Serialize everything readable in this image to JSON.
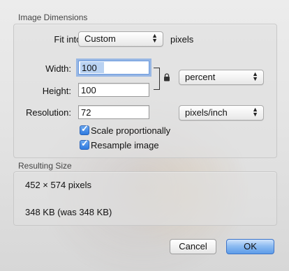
{
  "dimensions": {
    "title": "Image Dimensions",
    "fit_label": "Fit into:",
    "fit_value": "Custom",
    "fit_unit": "pixels",
    "width_label": "Width:",
    "width_value": "100",
    "height_label": "Height:",
    "height_value": "100",
    "size_unit": "percent",
    "resolution_label": "Resolution:",
    "resolution_value": "72",
    "resolution_unit": "pixels/inch",
    "scale_label": "Scale proportionally",
    "scale_checked": true,
    "resample_label": "Resample image",
    "resample_checked": true
  },
  "result": {
    "title": "Resulting Size",
    "pixels": "452 × 574 pixels",
    "size": "348 KB (was 348 KB)"
  },
  "buttons": {
    "cancel": "Cancel",
    "ok": "OK"
  },
  "colors": {
    "focus": "#5b93e5",
    "checkbox": "#2f7ae0",
    "default_button": "#5d9ce8"
  }
}
